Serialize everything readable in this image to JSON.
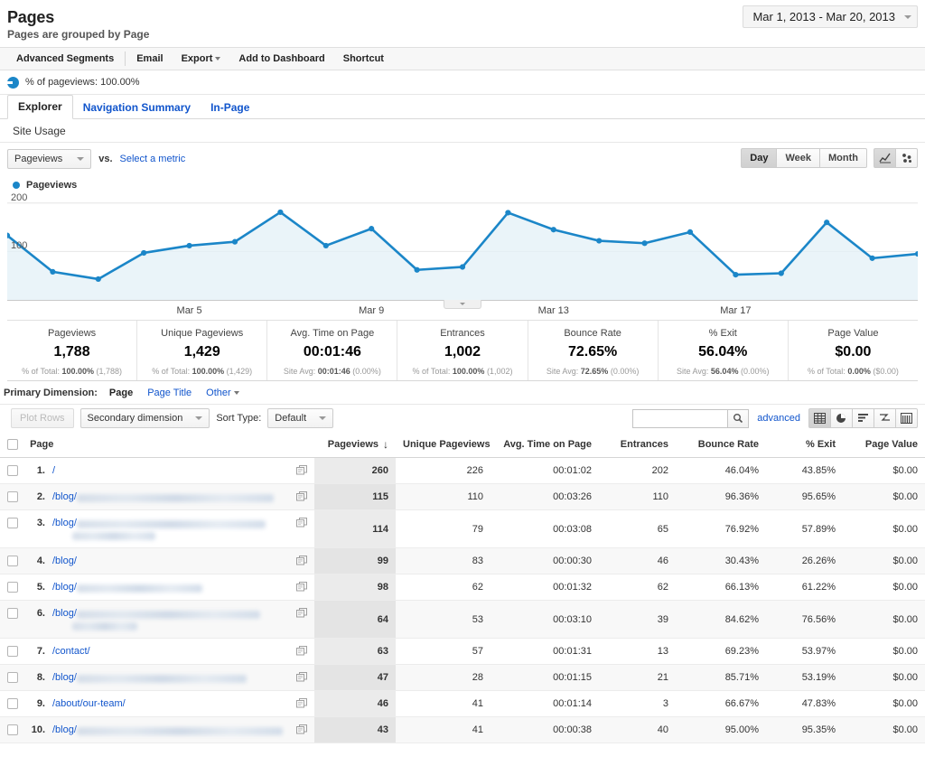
{
  "header": {
    "title": "Pages",
    "subtitle": "Pages are grouped by Page",
    "date_range": "Mar 1, 2013 - Mar 20, 2013"
  },
  "actionbar": {
    "items": [
      {
        "label": "Advanced Segments"
      },
      {
        "label": "Email"
      },
      {
        "label": "Export"
      },
      {
        "label": "Add to Dashboard"
      },
      {
        "label": "Shortcut"
      }
    ]
  },
  "pct_strip": {
    "label": "% of pageviews: 100.00%"
  },
  "tabs": [
    {
      "label": "Explorer",
      "active": true
    },
    {
      "label": "Navigation Summary",
      "active": false
    },
    {
      "label": "In-Page",
      "active": false
    }
  ],
  "site_usage": {
    "label": "Site Usage"
  },
  "metric_row": {
    "selected_metric": "Pageviews",
    "vs_label": "vs.",
    "select_metric_link": "Select a metric",
    "granularity": [
      {
        "label": "Day",
        "active": true
      },
      {
        "label": "Week",
        "active": false
      },
      {
        "label": "Month",
        "active": false
      }
    ],
    "chart_type_icons": [
      "line-chart-icon",
      "scatter-chart-icon"
    ]
  },
  "legend": {
    "label": "Pageviews"
  },
  "chart_data": {
    "type": "line",
    "title": "Pageviews",
    "xlabel": "",
    "ylabel": "Pageviews",
    "ylim": [
      0,
      220
    ],
    "yticks": [
      100,
      200
    ],
    "grid": true,
    "legend_position": "top-left",
    "series_color": "#1b86c8",
    "fill_color": "#e3f0f7",
    "x": [
      "Mar 1",
      "Mar 2",
      "Mar 3",
      "Mar 4",
      "Mar 5",
      "Mar 6",
      "Mar 7",
      "Mar 8",
      "Mar 9",
      "Mar 10",
      "Mar 11",
      "Mar 12",
      "Mar 13",
      "Mar 14",
      "Mar 15",
      "Mar 16",
      "Mar 17",
      "Mar 18",
      "Mar 19",
      "Mar 20"
    ],
    "tick_labels": [
      "Mar 5",
      "Mar 9",
      "Mar 13",
      "Mar 17"
    ],
    "series": [
      {
        "name": "Pageviews",
        "values": [
          133,
          58,
          43,
          97,
          112,
          120,
          181,
          112,
          147,
          62,
          68,
          180,
          145,
          122,
          117,
          140,
          52,
          55,
          160,
          86,
          95
        ]
      }
    ]
  },
  "summary_metrics": [
    {
      "name": "Pageviews",
      "value": "1,788",
      "sub_prefix": "% of Total:",
      "sub_bold": "100.00%",
      "sub_suffix": "(1,788)"
    },
    {
      "name": "Unique Pageviews",
      "value": "1,429",
      "sub_prefix": "% of Total:",
      "sub_bold": "100.00%",
      "sub_suffix": "(1,429)"
    },
    {
      "name": "Avg. Time on Page",
      "value": "00:01:46",
      "sub_prefix": "Site Avg:",
      "sub_bold": "00:01:46",
      "sub_suffix": "(0.00%)"
    },
    {
      "name": "Entrances",
      "value": "1,002",
      "sub_prefix": "% of Total:",
      "sub_bold": "100.00%",
      "sub_suffix": "(1,002)"
    },
    {
      "name": "Bounce Rate",
      "value": "72.65%",
      "sub_prefix": "Site Avg:",
      "sub_bold": "72.65%",
      "sub_suffix": "(0.00%)"
    },
    {
      "name": "% Exit",
      "value": "56.04%",
      "sub_prefix": "Site Avg:",
      "sub_bold": "56.04%",
      "sub_suffix": "(0.00%)"
    },
    {
      "name": "Page Value",
      "value": "$0.00",
      "sub_prefix": "% of Total:",
      "sub_bold": "0.00%",
      "sub_suffix": "($0.00)"
    }
  ],
  "primary_dimension": {
    "label": "Primary Dimension:",
    "options": [
      {
        "label": "Page",
        "selected": true
      },
      {
        "label": "Page Title",
        "selected": false
      },
      {
        "label": "Other",
        "selected": false,
        "has_caret": true
      }
    ]
  },
  "table_toolbar": {
    "plot_rows": "Plot Rows",
    "secondary_dimension": "Secondary dimension",
    "sort_type_label": "Sort Type:",
    "sort_type_value": "Default",
    "search_value": "",
    "search_placeholder": "",
    "advanced_link": "advanced",
    "view_icons": [
      "table-view-icon",
      "pie-view-icon",
      "bar-view-icon",
      "comparison-view-icon",
      "pivot-view-icon"
    ]
  },
  "table": {
    "columns": [
      "Page",
      "Pageviews",
      "Unique Pageviews",
      "Avg. Time on Page",
      "Entrances",
      "Bounce Rate",
      "% Exit",
      "Page Value"
    ],
    "sorted_column": "Pageviews",
    "sort_direction": "desc",
    "rows": [
      {
        "num": "1.",
        "page": "/",
        "redacted": false,
        "redacted_widths": [],
        "pageviews": "260",
        "unique_pageviews": "226",
        "avg_time": "00:01:02",
        "entrances": "202",
        "bounce_rate": "46.04%",
        "exit": "43.85%",
        "page_value": "$0.00"
      },
      {
        "num": "2.",
        "page": "/blog/",
        "redacted": true,
        "redacted_widths": [
          218
        ],
        "pageviews": "115",
        "unique_pageviews": "110",
        "avg_time": "00:03:26",
        "entrances": "110",
        "bounce_rate": "96.36%",
        "exit": "95.65%",
        "page_value": "$0.00"
      },
      {
        "num": "3.",
        "page": "/blog/",
        "redacted": true,
        "redacted_widths": [
          209,
          92
        ],
        "pageviews": "114",
        "unique_pageviews": "79",
        "avg_time": "00:03:08",
        "entrances": "65",
        "bounce_rate": "76.92%",
        "exit": "57.89%",
        "page_value": "$0.00"
      },
      {
        "num": "4.",
        "page": "/blog/",
        "redacted": false,
        "redacted_widths": [],
        "pageviews": "99",
        "unique_pageviews": "83",
        "avg_time": "00:00:30",
        "entrances": "46",
        "bounce_rate": "30.43%",
        "exit": "26.26%",
        "page_value": "$0.00"
      },
      {
        "num": "5.",
        "page": "/blog/",
        "redacted": true,
        "redacted_widths": [
          139
        ],
        "pageviews": "98",
        "unique_pageviews": "62",
        "avg_time": "00:01:32",
        "entrances": "62",
        "bounce_rate": "66.13%",
        "exit": "61.22%",
        "page_value": "$0.00"
      },
      {
        "num": "6.",
        "page": "/blog/",
        "redacted": true,
        "redacted_widths": [
          203,
          72
        ],
        "pageviews": "64",
        "unique_pageviews": "53",
        "avg_time": "00:03:10",
        "entrances": "39",
        "bounce_rate": "84.62%",
        "exit": "76.56%",
        "page_value": "$0.00"
      },
      {
        "num": "7.",
        "page": "/contact/",
        "redacted": false,
        "redacted_widths": [],
        "pageviews": "63",
        "unique_pageviews": "57",
        "avg_time": "00:01:31",
        "entrances": "13",
        "bounce_rate": "69.23%",
        "exit": "53.97%",
        "page_value": "$0.00"
      },
      {
        "num": "8.",
        "page": "/blog/",
        "redacted": true,
        "redacted_widths": [
          188
        ],
        "pageviews": "47",
        "unique_pageviews": "28",
        "avg_time": "00:01:15",
        "entrances": "21",
        "bounce_rate": "85.71%",
        "exit": "53.19%",
        "page_value": "$0.00"
      },
      {
        "num": "9.",
        "page": "/about/our-team/",
        "redacted": false,
        "redacted_widths": [],
        "pageviews": "46",
        "unique_pageviews": "41",
        "avg_time": "00:01:14",
        "entrances": "3",
        "bounce_rate": "66.67%",
        "exit": "47.83%",
        "page_value": "$0.00"
      },
      {
        "num": "10.",
        "page": "/blog/",
        "redacted": true,
        "redacted_widths": [
          228
        ],
        "pageviews": "43",
        "unique_pageviews": "41",
        "avg_time": "00:00:38",
        "entrances": "40",
        "bounce_rate": "95.00%",
        "exit": "95.35%",
        "page_value": "$0.00"
      }
    ]
  }
}
